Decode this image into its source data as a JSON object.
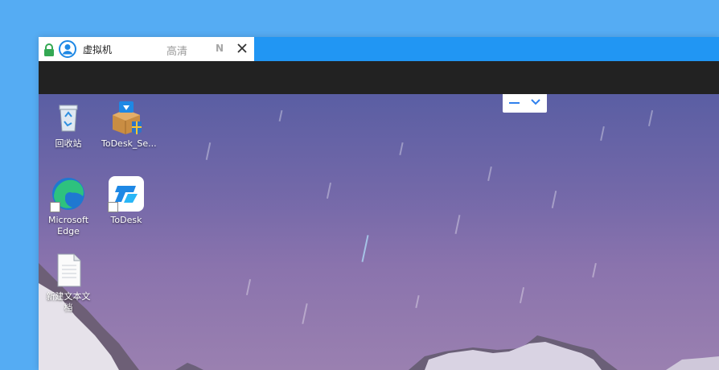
{
  "tab": {
    "title": "虚拟机",
    "quality": "高清",
    "network": "N"
  },
  "desktop": {
    "icons": [
      {
        "label": "回收站"
      },
      {
        "label": "ToDesk_Se..."
      },
      {
        "label": "Microsoft Edge"
      },
      {
        "label": "ToDesk"
      },
      {
        "label": "新建文本文档"
      }
    ]
  },
  "colors": {
    "outer_background": "#55acf3",
    "tab_background": "#ffffff",
    "toolbar_background": "#222222",
    "accent": "#2196f3",
    "lock_green": "#34a853"
  }
}
